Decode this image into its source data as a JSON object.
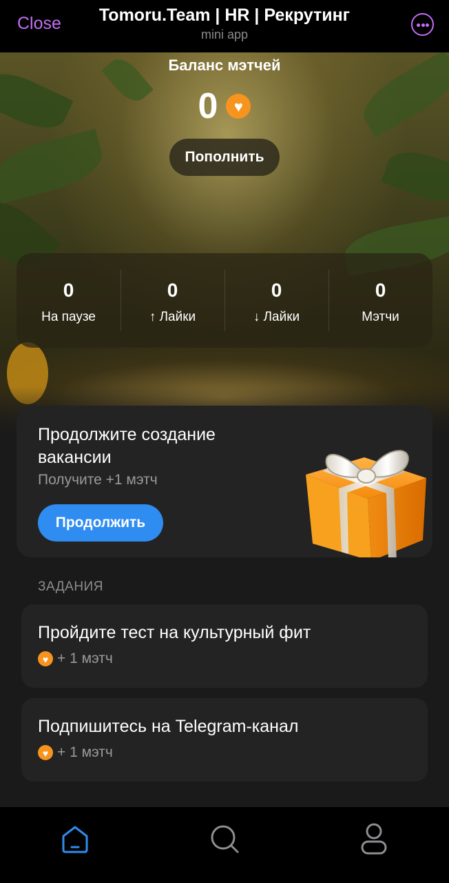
{
  "header": {
    "close_label": "Close",
    "title": "Tomoru.Team | HR | Рекрутинг",
    "subtitle": "mini app",
    "menu_icon": "more-icon"
  },
  "balance": {
    "title": "Баланс мэтчей",
    "value": "0",
    "coin_icon": "heart-coin-icon",
    "topup_label": "Пополнить"
  },
  "stats": [
    {
      "value": "0",
      "label": "На паузе"
    },
    {
      "value": "0",
      "label": "↑ Лайки"
    },
    {
      "value": "0",
      "label": "↓ Лайки"
    },
    {
      "value": "0",
      "label": "Мэтчи"
    }
  ],
  "promo": {
    "title": "Продолжите создание вакансии",
    "subtitle": "Получите +1 мэтч",
    "button_label": "Продолжить",
    "image_icon": "gift-icon"
  },
  "tasks_section": {
    "label": "ЗАДАНИЯ",
    "items": [
      {
        "title": "Пройдите тест на культурный фит",
        "reward": "+ 1 мэтч"
      },
      {
        "title": "Подпишитесь на Telegram-канал",
        "reward": "+ 1 мэтч"
      }
    ]
  },
  "bottom_nav": {
    "items": [
      {
        "icon": "home-icon",
        "active": true
      },
      {
        "icon": "search-icon",
        "active": false
      },
      {
        "icon": "profile-icon",
        "active": false
      }
    ]
  },
  "colors": {
    "accent_purple": "#c56ef6",
    "primary_blue": "#2f8cf0",
    "coin_orange": "#f7941d",
    "card_bg": "#232323",
    "page_bg": "#1a1a1a"
  }
}
